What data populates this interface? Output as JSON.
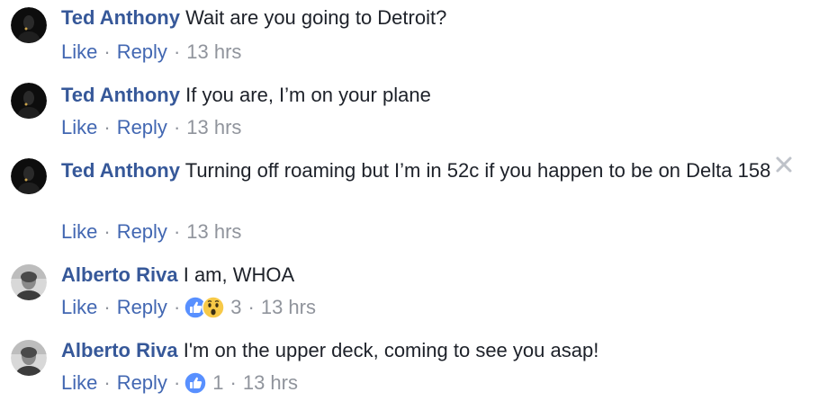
{
  "comments": [
    {
      "author": "Ted Anthony",
      "avatar_icon": "dark-portrait-avatar",
      "text": "Wait are you going to Detroit?",
      "like_label": "Like",
      "reply_label": "Reply",
      "time": "13 hrs"
    },
    {
      "author": "Ted Anthony",
      "avatar_icon": "dark-portrait-avatar",
      "text": "If you are, I’m on your plane",
      "like_label": "Like",
      "reply_label": "Reply",
      "time": "13 hrs"
    },
    {
      "author": "Ted Anthony",
      "avatar_icon": "dark-portrait-avatar",
      "text": "Turning off roaming but I’m in 52c if you happen to be on Delta 158",
      "like_label": "Like",
      "reply_label": "Reply",
      "time": "13 hrs",
      "close_icon": "close-icon"
    },
    {
      "author": "Alberto Riva",
      "avatar_icon": "grey-portrait-avatar",
      "text": "I am, WHOA",
      "like_label": "Like",
      "reply_label": "Reply",
      "reactions": [
        "like-reaction-icon",
        "wow-reaction-icon"
      ],
      "reaction_count": "3",
      "time": "13 hrs"
    },
    {
      "author": "Alberto Riva",
      "avatar_icon": "grey-portrait-avatar",
      "text": "I'm on the upper deck, coming to see you asap!",
      "like_label": "Like",
      "reply_label": "Reply",
      "reactions": [
        "like-reaction-icon"
      ],
      "reaction_count": "1",
      "time": "13 hrs"
    }
  ],
  "separator": "·",
  "colors": {
    "author": "#365899",
    "link": "#4267b2",
    "meta": "#90949c",
    "text": "#1d2129",
    "like_reaction": "#5890ff",
    "wow_reaction": "#f7c948"
  }
}
